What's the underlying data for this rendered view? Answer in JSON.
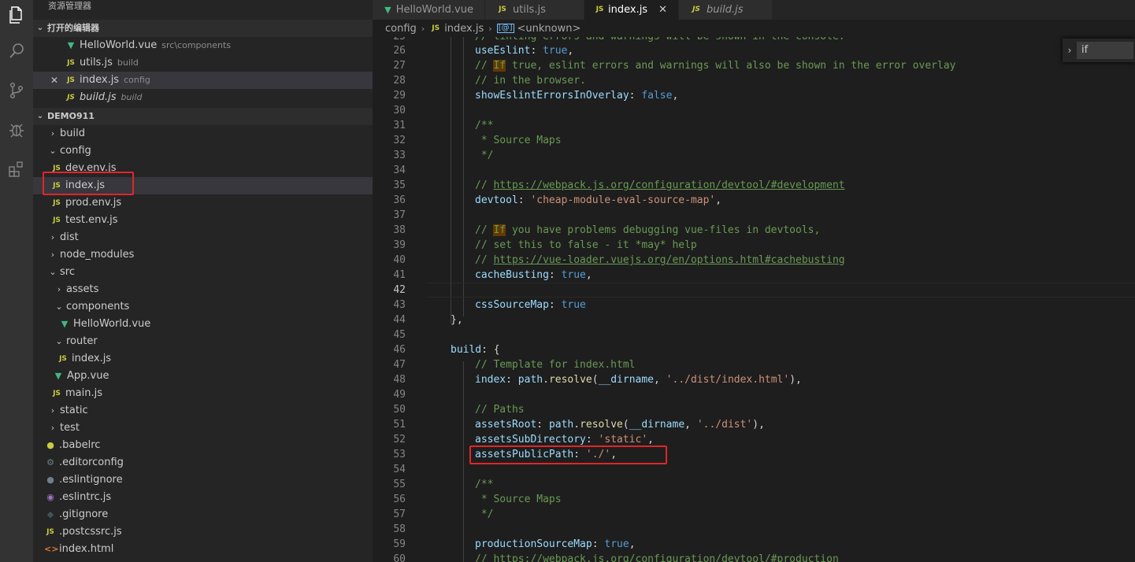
{
  "explorer": {
    "title": "资源管理器",
    "open_editors": {
      "label": "打开的编辑器",
      "items": [
        {
          "name": "HelloWorld.vue",
          "desc": "src\\components",
          "icon": "vue"
        },
        {
          "name": "utils.js",
          "desc": "build",
          "icon": "js"
        },
        {
          "name": "index.js",
          "desc": "config",
          "icon": "js",
          "close": "✕"
        },
        {
          "name": "build.js",
          "desc": "build",
          "icon": "js"
        }
      ]
    },
    "project": {
      "label": "DEMO911",
      "tree": [
        {
          "name": "build",
          "type": "folder-closed"
        },
        {
          "name": "config",
          "type": "folder-open"
        },
        {
          "name": "dev.env.js",
          "type": "js"
        },
        {
          "name": "index.js",
          "type": "js"
        },
        {
          "name": "prod.env.js",
          "type": "js"
        },
        {
          "name": "test.env.js",
          "type": "js"
        },
        {
          "name": "dist",
          "type": "folder-closed"
        },
        {
          "name": "node_modules",
          "type": "folder-closed"
        },
        {
          "name": "src",
          "type": "folder-open"
        },
        {
          "name": "assets",
          "type": "folder-closed"
        },
        {
          "name": "components",
          "type": "folder-open"
        },
        {
          "name": "HelloWorld.vue",
          "type": "vue"
        },
        {
          "name": "router",
          "type": "folder-open"
        },
        {
          "name": "index.js",
          "type": "js"
        },
        {
          "name": "App.vue",
          "type": "vue"
        },
        {
          "name": "main.js",
          "type": "js"
        },
        {
          "name": "static",
          "type": "folder-closed"
        },
        {
          "name": "test",
          "type": "folder-closed"
        },
        {
          "name": ".babelrc",
          "type": "babel"
        },
        {
          "name": ".editorconfig",
          "type": "gear"
        },
        {
          "name": ".eslintignore",
          "type": "dot"
        },
        {
          "name": ".eslintrc.js",
          "type": "eslint"
        },
        {
          "name": ".gitignore",
          "type": "git"
        },
        {
          "name": ".postcssrc.js",
          "type": "js"
        },
        {
          "name": "index.html",
          "type": "html"
        }
      ]
    }
  },
  "tabs": [
    {
      "label": "HelloWorld.vue",
      "icon": "vue"
    },
    {
      "label": "utils.js",
      "icon": "js"
    },
    {
      "label": "index.js",
      "icon": "js",
      "close": "✕"
    },
    {
      "label": "build.js",
      "icon": "js"
    }
  ],
  "breadcrumb": {
    "folder": "config",
    "file": "index.js",
    "symbol": "<unknown>"
  },
  "find": {
    "value": "if"
  },
  "editor": {
    "current_line": "42",
    "lines": {
      "l25": {
        "n": "25",
        "t": "// linting errors and warnings will be shown in the console."
      },
      "l26": {
        "n": "26",
        "k": "useEslint",
        "v": "true"
      },
      "l27": {
        "n": "27",
        "pre": "// ",
        "m": "If",
        "post": " true, eslint errors and warnings will also be shown in the error overlay"
      },
      "l28": {
        "n": "28",
        "t": "// in the browser."
      },
      "l29": {
        "n": "29",
        "k": "showEslintErrorsInOverlay",
        "v": "false"
      },
      "l30": {
        "n": "30"
      },
      "l31": {
        "n": "31",
        "t": "/**"
      },
      "l32": {
        "n": "32",
        "t": " * Source Maps"
      },
      "l33": {
        "n": "33",
        "t": " */"
      },
      "l34": {
        "n": "34"
      },
      "l35": {
        "n": "35",
        "pre": "// ",
        "url": "https://webpack.js.org/configuration/devtool/#development"
      },
      "l36": {
        "n": "36",
        "k": "devtool",
        "s": "'cheap-module-eval-source-map'"
      },
      "l37": {
        "n": "37"
      },
      "l38": {
        "n": "38",
        "pre": "// ",
        "m": "If",
        "post": " you have problems debugging vue-files in devtools,"
      },
      "l39": {
        "n": "39",
        "t": "// set this to false - it *may* help"
      },
      "l40": {
        "n": "40",
        "pre": "// ",
        "url": "https://vue-loader.vuejs.org/en/options.html#cachebusting"
      },
      "l41": {
        "n": "41",
        "k": "cacheBusting",
        "v": "true"
      },
      "l42": {
        "n": "42"
      },
      "l43": {
        "n": "43",
        "k": "cssSourceMap",
        "v": "true"
      },
      "l44": {
        "n": "44",
        "t": "},"
      },
      "l45": {
        "n": "45"
      },
      "l46": {
        "n": "46",
        "k": "build",
        "t": ": {"
      },
      "l47": {
        "n": "47",
        "t": "// Template for index.html"
      },
      "l48": {
        "n": "48",
        "k": "index",
        "obj": "path",
        "fn": "resolve",
        "arg": "__dirname",
        "s": "'../dist/index.html'"
      },
      "l49": {
        "n": "49"
      },
      "l50": {
        "n": "50",
        "t": "// Paths"
      },
      "l51": {
        "n": "51",
        "k": "assetsRoot",
        "obj": "path",
        "fn": "resolve",
        "arg": "__dirname",
        "s": "'../dist'"
      },
      "l52": {
        "n": "52",
        "k": "assetsSubDirectory",
        "s": "'static'"
      },
      "l53": {
        "n": "53",
        "k": "assetsPublicPath",
        "s": "'./'"
      },
      "l54": {
        "n": "54"
      },
      "l55": {
        "n": "55",
        "t": "/**"
      },
      "l56": {
        "n": "56",
        "t": " * Source Maps"
      },
      "l57": {
        "n": "57",
        "t": " */"
      },
      "l58": {
        "n": "58"
      },
      "l59": {
        "n": "59",
        "k": "productionSourceMap",
        "v": "true"
      },
      "l60": {
        "n": "60",
        "pre": "// ",
        "url": "https://webpack.js.org/configuration/devtool/#production"
      }
    }
  },
  "colors": {
    "annotation_red": "#e0262a",
    "js_yellow": "#cbcb41",
    "vue_green": "#41b883"
  }
}
